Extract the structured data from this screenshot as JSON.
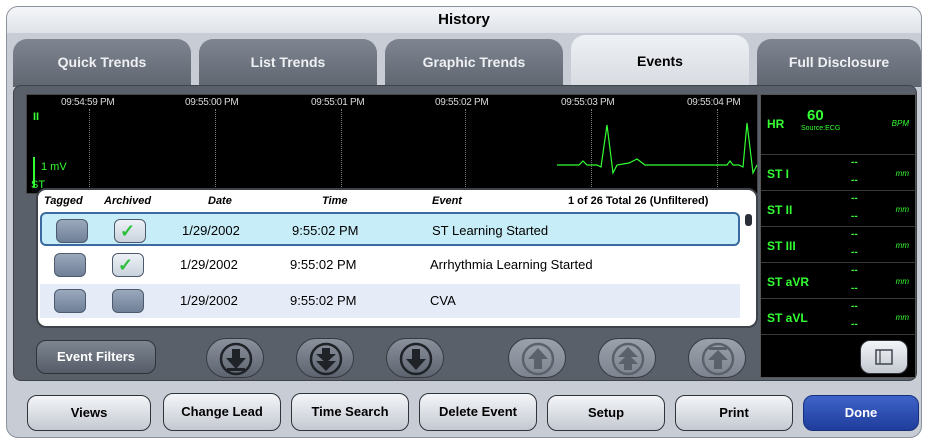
{
  "window": {
    "title": "History"
  },
  "tabs": [
    {
      "label": "Quick Trends",
      "active": false
    },
    {
      "label": "List Trends",
      "active": false
    },
    {
      "label": "Graphic Trends",
      "active": false
    },
    {
      "label": "Events",
      "active": true
    },
    {
      "label": "Full Disclosure",
      "active": false
    }
  ],
  "ecg": {
    "times": [
      "09:54:59 PM",
      "09:55:00 PM",
      "09:55:01 PM",
      "09:55:02 PM",
      "09:55:03 PM",
      "09:55:04 PM"
    ],
    "lead": "II",
    "scale": "1 mV",
    "st": "ST",
    "trace_color": "#33ff33"
  },
  "vitals": {
    "hr": {
      "label": "HR",
      "value": "60",
      "unit": "BPM",
      "source": "Source:ECG"
    },
    "st_rows": [
      {
        "label": "ST I",
        "value": "--",
        "value2": "--",
        "unit": "mm"
      },
      {
        "label": "ST II",
        "value": "--",
        "value2": "--",
        "unit": "mm"
      },
      {
        "label": "ST III",
        "value": "--",
        "value2": "--",
        "unit": "mm"
      },
      {
        "label": "ST aVR",
        "value": "--",
        "value2": "--",
        "unit": "mm"
      },
      {
        "label": "ST aVL",
        "value": "--",
        "value2": "--",
        "unit": "mm"
      }
    ]
  },
  "events": {
    "headers": {
      "tagged": "Tagged",
      "archived": "Archived",
      "date": "Date",
      "time": "Time",
      "event": "Event"
    },
    "count": "1 of 26 Total 26 (Unfiltered)",
    "rows": [
      {
        "tagged": false,
        "archived": true,
        "date": "1/29/2002",
        "time": "9:55:02 PM",
        "event": "ST Learning Started",
        "selected": true
      },
      {
        "tagged": false,
        "archived": true,
        "date": "1/29/2002",
        "time": "9:55:02 PM",
        "event": "Arrhythmia Learning Started",
        "selected": false
      },
      {
        "tagged": false,
        "archived": false,
        "date": "1/29/2002",
        "time": "9:55:02 PM",
        "event": "CVA",
        "selected": false
      }
    ]
  },
  "nav": {
    "event_filters": "Event Filters",
    "buttons": [
      {
        "name": "scroll-bottom-button",
        "icon": "arrow-down-bar-icon",
        "enabled": true
      },
      {
        "name": "page-down-button",
        "icon": "double-arrow-down-icon",
        "enabled": true
      },
      {
        "name": "step-down-button",
        "icon": "arrow-down-icon",
        "enabled": true
      },
      {
        "name": "step-up-button",
        "icon": "arrow-up-icon",
        "enabled": false
      },
      {
        "name": "page-up-button",
        "icon": "double-arrow-up-icon",
        "enabled": false
      },
      {
        "name": "scroll-top-button",
        "icon": "arrow-up-bar-icon",
        "enabled": false
      }
    ]
  },
  "footer": {
    "views": "Views",
    "change_lead": "Change Lead",
    "time_search": "Time Search",
    "delete_event": "Delete Event",
    "setup": "Setup",
    "print": "Print",
    "done": "Done"
  }
}
